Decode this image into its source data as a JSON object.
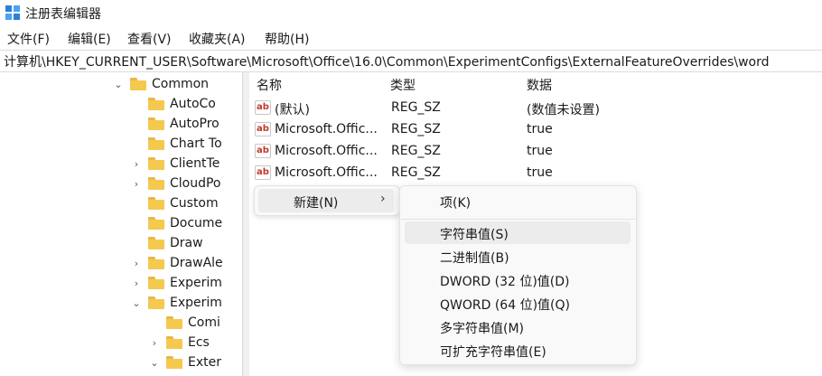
{
  "window": {
    "title": "注册表编辑器"
  },
  "menubar": [
    "文件(F)",
    "编辑(E)",
    "查看(V)",
    "收藏夹(A)",
    "帮助(H)"
  ],
  "address": "计算机\\HKEY_CURRENT_USER\\Software\\Microsoft\\Office\\16.0\\Common\\ExperimentConfigs\\ExternalFeatureOverrides\\word",
  "tree": [
    {
      "label": "Common",
      "chevron": "v"
    },
    {
      "label": "AutoCo",
      "chevron": ""
    },
    {
      "label": "AutoPro",
      "chevron": ""
    },
    {
      "label": "Chart To",
      "chevron": ""
    },
    {
      "label": "ClientTe",
      "chevron": ">"
    },
    {
      "label": "CloudPo",
      "chevron": ">"
    },
    {
      "label": "Custom",
      "chevron": ""
    },
    {
      "label": "Docume",
      "chevron": ""
    },
    {
      "label": "Draw",
      "chevron": ""
    },
    {
      "label": "DrawAle",
      "chevron": ">"
    },
    {
      "label": "Experim",
      "chevron": ">"
    },
    {
      "label": "Experim",
      "chevron": "v"
    },
    {
      "label": "Comi",
      "chevron": ""
    },
    {
      "label": "Ecs",
      "chevron": ">"
    },
    {
      "label": "Exter",
      "chevron": "v"
    }
  ],
  "list": {
    "headers": {
      "name": "名称",
      "type": "类型",
      "data": "数据"
    },
    "rows": [
      {
        "name": "(默认)",
        "type": "REG_SZ",
        "data": "(数值未设置)"
      },
      {
        "name": "Microsoft.Offic...",
        "type": "REG_SZ",
        "data": "true"
      },
      {
        "name": "Microsoft.Offic...",
        "type": "REG_SZ",
        "data": "true"
      },
      {
        "name": "Microsoft.Offic...",
        "type": "REG_SZ",
        "data": "true"
      }
    ]
  },
  "context_menu": {
    "new_label": "新建(N)",
    "arrow": "›"
  },
  "submenu": [
    "项(K)",
    "字符串值(S)",
    "二进制值(B)",
    "DWORD (32 位)值(D)",
    "QWORD (64 位)值(Q)",
    "多字符串值(M)",
    "可扩充字符串值(E)"
  ],
  "icons": {
    "app": "registry-editor-icon",
    "value": "string-value-icon",
    "folder": "folder-icon"
  },
  "colors": {
    "folder": "#f5c84e",
    "hover": "#ececec"
  }
}
